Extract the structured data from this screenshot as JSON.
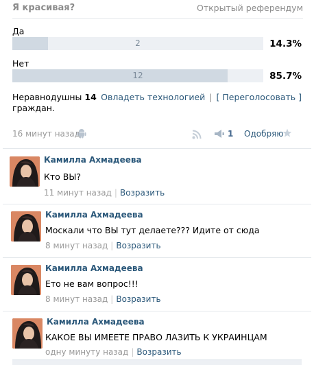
{
  "poll": {
    "title": "Я красивая?",
    "type": "Открытый референдум",
    "options": [
      {
        "label": "Да",
        "count": "2",
        "percent": "14.3%",
        "fraction": 0.143
      },
      {
        "label": "Нет",
        "count": "12",
        "percent": "85.7%",
        "fraction": 0.857
      }
    ],
    "voters_prefix": "Неравнодушны",
    "voters_count": "14",
    "voters_suffix": "граждан.",
    "links": {
      "tech": "Овладеть технологией",
      "revote": "[ Переголосовать ]"
    }
  },
  "meta": {
    "time": "16 минут назад",
    "share_count": "1",
    "like_label": "Одобряю",
    "icons": [
      "android-icon",
      "rss-icon",
      "share-icon",
      "star-icon"
    ]
  },
  "comments": [
    {
      "author": "Камилла Ахмадеева",
      "text": "Кто ВЫ?",
      "time": "11 минут назад",
      "reply": "Возразить"
    },
    {
      "author": "Камилла Ахмадеева",
      "text": "Москали что ВЫ тут делаете??? Идите от сюда",
      "time": "8 минут назад",
      "reply": "Возразить"
    },
    {
      "author": "Камилла Ахмадеева",
      "text": "Ето не вам вопрос!!!",
      "time": "8 минут назад",
      "reply": "Возразить"
    },
    {
      "author": "Камилла Ахмадеева",
      "text": "КАКОЕ ВЫ ИМЕЕТЕ ПРАВО ЛАЗИТЬ К УКРАИНЦАМ",
      "time": "одну минуту назад",
      "reply": "Возразить"
    }
  ],
  "colors": {
    "link": "#2b587a",
    "bar_bg": "#edf0f4",
    "bar_fill": "#d0d9e2",
    "muted": "#999999"
  }
}
